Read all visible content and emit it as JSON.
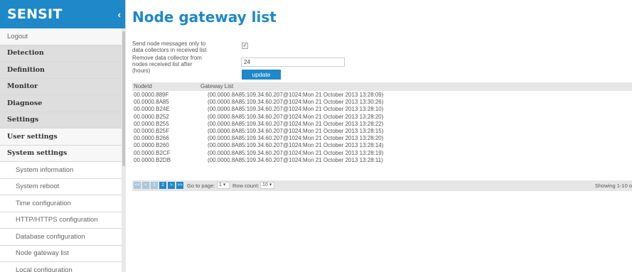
{
  "sidebar": {
    "brand": "SENSIT",
    "collapse_icon": "chevron-left-icon",
    "items": [
      {
        "label": "Logout",
        "style": "plain",
        "name": "sidebar-item-logout"
      },
      {
        "label": "Detection",
        "style": "gray",
        "name": "sidebar-item-detection"
      },
      {
        "label": "Definition",
        "style": "gray",
        "name": "sidebar-item-definition"
      },
      {
        "label": "Monitor",
        "style": "gray",
        "name": "sidebar-item-monitor"
      },
      {
        "label": "Diagnose",
        "style": "gray",
        "name": "sidebar-item-diagnose"
      },
      {
        "label": "Settings",
        "style": "gray",
        "name": "sidebar-item-settings"
      },
      {
        "label": "User settings",
        "style": "bold",
        "name": "sidebar-item-user-settings"
      },
      {
        "label": "System settings",
        "style": "bold",
        "name": "sidebar-item-system-settings"
      },
      {
        "label": "System information",
        "style": "sub",
        "name": "sidebar-item-system-information"
      },
      {
        "label": "System reboot",
        "style": "sub",
        "name": "sidebar-item-system-reboot"
      },
      {
        "label": "Time configuration",
        "style": "sub",
        "name": "sidebar-item-time-configuration"
      },
      {
        "label": "HTTP/HTTPS configuration",
        "style": "sub",
        "name": "sidebar-item-http-https-configuration"
      },
      {
        "label": "Database configuration",
        "style": "sub",
        "name": "sidebar-item-database-configuration"
      },
      {
        "label": "Node gateway list",
        "style": "sub",
        "name": "sidebar-item-node-gateway-list"
      },
      {
        "label": "Local configuration",
        "style": "sub",
        "name": "sidebar-item-local-configuration"
      }
    ]
  },
  "page": {
    "title": "Node gateway list",
    "checkbox_label": "Send node messages only to data collectors in received list",
    "checkbox_checked": true,
    "hours_label": "Remove data collector from nodes received list after (hours)",
    "hours_value": "24",
    "update_label": "update"
  },
  "table": {
    "headers": {
      "node_id": "NodeId",
      "gateway_list": "Gateway List"
    },
    "rows": [
      {
        "node_id": "00.0000.889F",
        "gateway_list": "(00.0000.8A85:109.34.60.207@1024:Mon 21 October 2013 13:28:09)"
      },
      {
        "node_id": "00.0000.8A85",
        "gateway_list": "(00.0000.8A85:109.34.60.207@1024:Mon 21 October 2013 13:30:26)"
      },
      {
        "node_id": "00.0000.B24E",
        "gateway_list": "(00.0000.8A85:109.34.60.207@1024:Mon 21 October 2013 13:28:10)"
      },
      {
        "node_id": "00.0000.B252",
        "gateway_list": "(00.0000.8A85:109.34.60.207@1024:Mon 21 October 2013 13:28:20)"
      },
      {
        "node_id": "00.0000.B255",
        "gateway_list": "(00.0000.8A85:109.34.60.207@1024:Mon 21 October 2013 13:28:22)"
      },
      {
        "node_id": "00.0000.B25F",
        "gateway_list": "(00.0000.8A85:109.34.60.207@1024:Mon 21 October 2013 13:28:15)"
      },
      {
        "node_id": "00.0000.B266",
        "gateway_list": "(00.0000.8A85:109.34.60.207@1024:Mon 21 October 2013 13:28:20)"
      },
      {
        "node_id": "00.0000.B260",
        "gateway_list": "(00.0000.8A85:109.34.60.207@1024:Mon 21 October 2013 13:28:14)"
      },
      {
        "node_id": "00.0000.B2CF",
        "gateway_list": "(00.0000.8A85:109.34.60.207@1024:Mon 21 October 2013 13:28:19)"
      },
      {
        "node_id": "00.0000.B2DB",
        "gateway_list": "(00.0000.8A85:109.34.60.207@1024:Mon 21 October 2013 13:28:11)"
      }
    ]
  },
  "pager": {
    "first": "<<",
    "prev": "<",
    "page_1": "1",
    "page_2": "2",
    "next": ">",
    "last": ">>",
    "goto_label": "Go to page:",
    "goto_value": "1 ▾",
    "rowcount_label": "Row count:",
    "rowcount_value": "10 ▾",
    "showing": "Showing 1-10 o"
  },
  "colors": {
    "accent": "#1e88c8"
  }
}
